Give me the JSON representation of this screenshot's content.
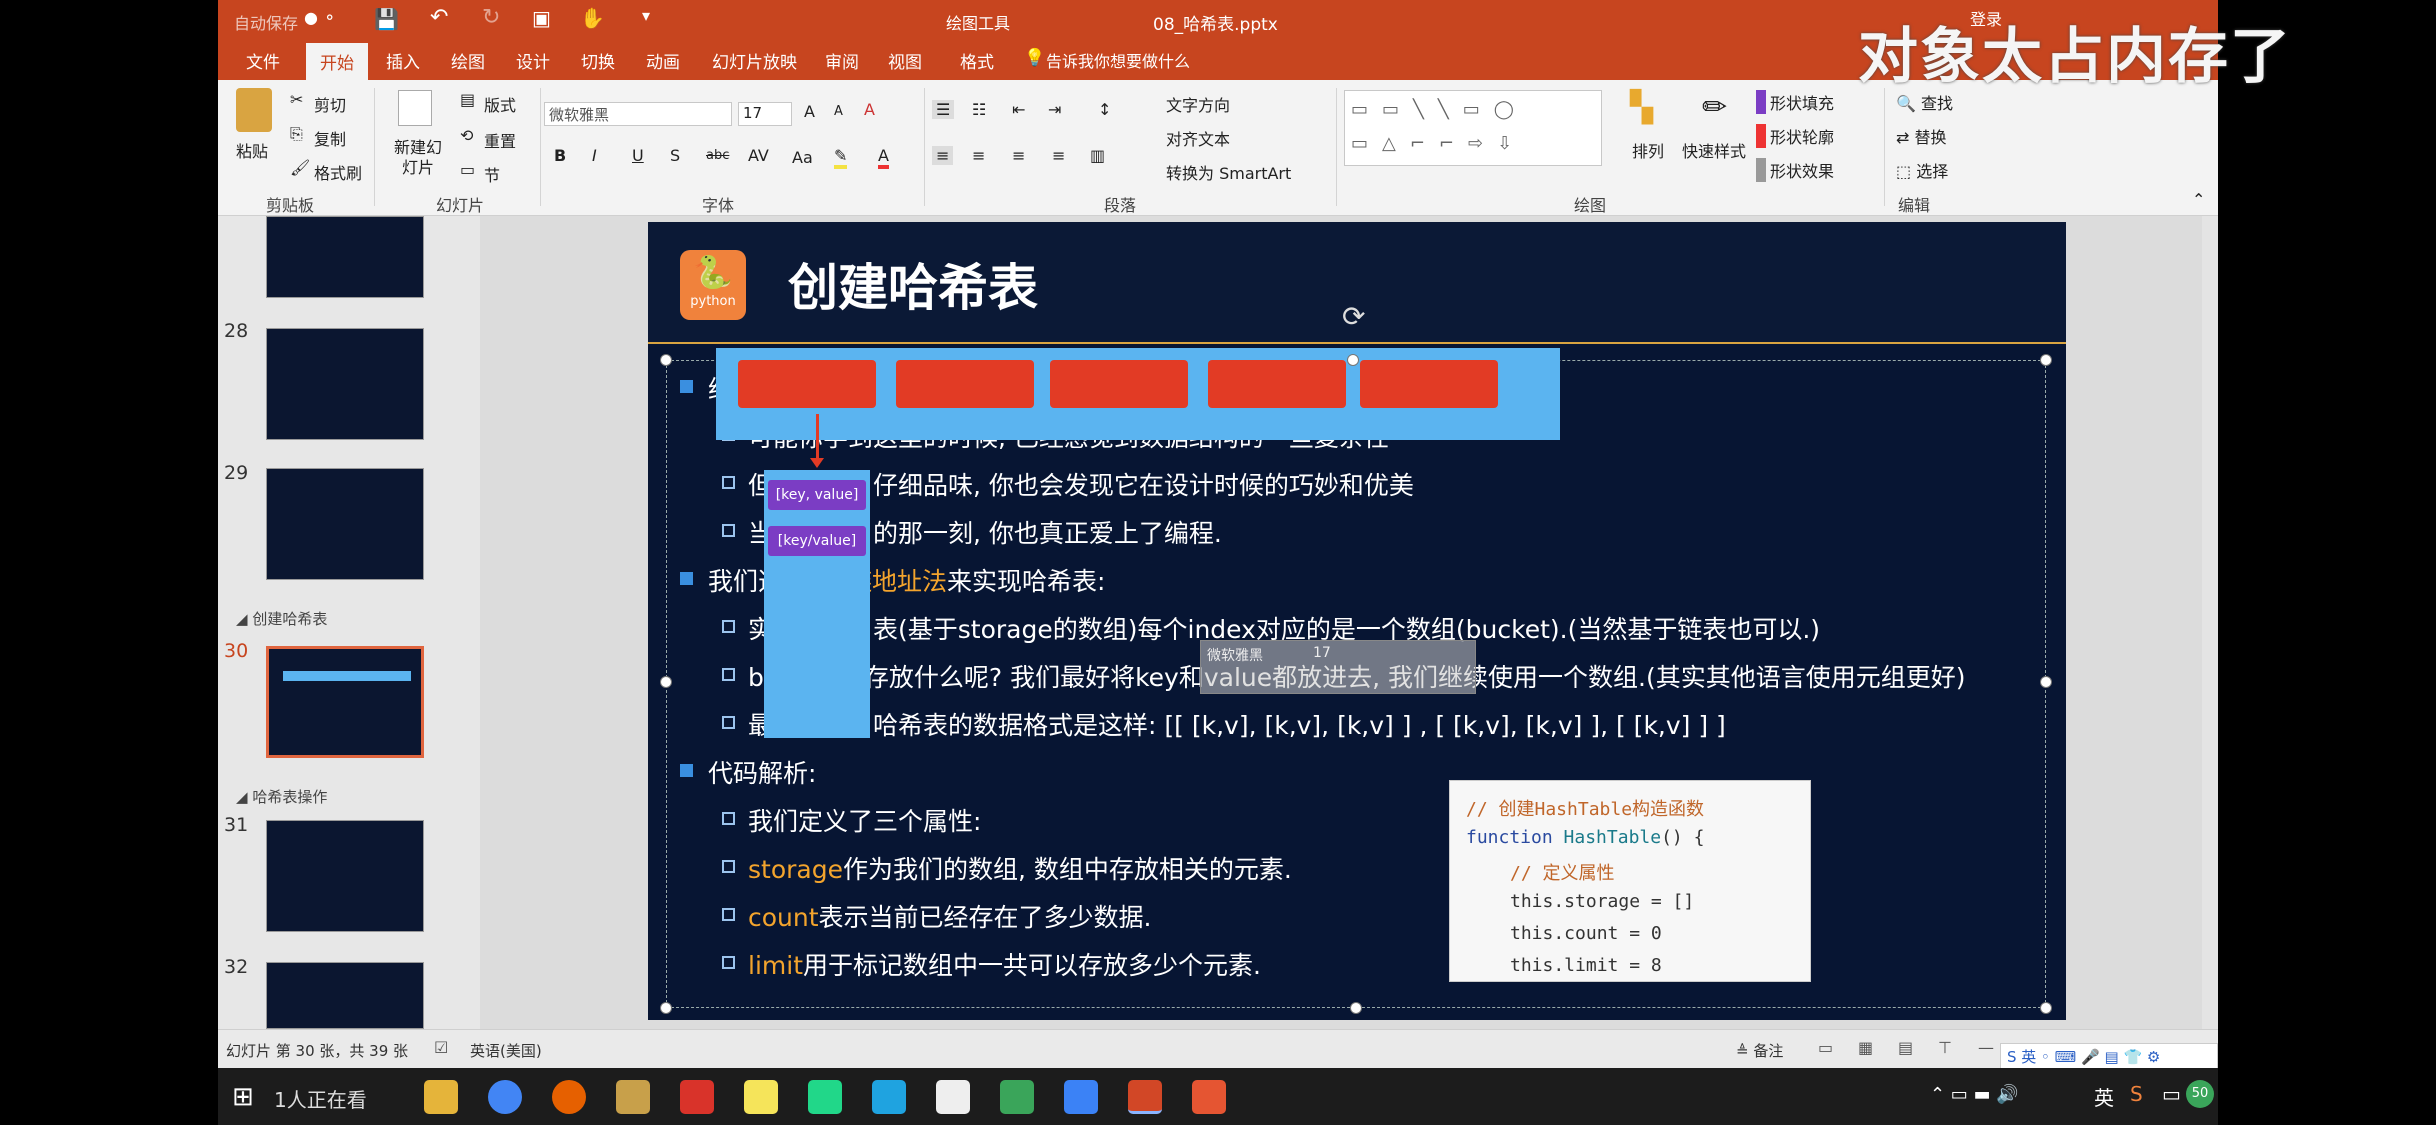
{
  "overlay_caption": "对象太占内存了",
  "titlebar": {
    "autosave": "自动保存",
    "drawing_tools": "绘图工具",
    "filename": "08_哈希表.pptx",
    "login": "登录"
  },
  "tabs": [
    "文件",
    "开始",
    "插入",
    "绘图",
    "设计",
    "切换",
    "动画",
    "幻灯片放映",
    "审阅",
    "视图",
    "格式"
  ],
  "tell_me": "告诉我你想要做什么",
  "ribbon": {
    "paste": "粘贴",
    "cut": "剪切",
    "copy": "复制",
    "format_painter": "格式刷",
    "clipboard_group": "剪贴板",
    "new_slide": "新建幻灯片",
    "layout": "版式",
    "reset": "重置",
    "section": "节",
    "slides_group": "幻灯片",
    "font_name": "微软雅黑",
    "font_size": "17",
    "font_group": "字体",
    "text_direction": "文字方向",
    "align_text": "对齐文本",
    "convert_smartart": "转换为 SmartArt",
    "paragraph_group": "段落",
    "arrange": "排列",
    "quick_styles": "快速样式",
    "shape_fill": "形状填充",
    "shape_outline": "形状轮廓",
    "shape_effects": "形状效果",
    "drawing_group": "绘图",
    "find": "查找",
    "replace": "替换",
    "select": "选择",
    "editing_group": "编辑"
  },
  "thumbnails": [
    {
      "num": "",
      "section": ""
    },
    {
      "num": "28",
      "section": ""
    },
    {
      "num": "29",
      "section": ""
    },
    {
      "num": "30",
      "section": "创建哈希表"
    },
    {
      "num": "31",
      "section": "哈希表操作"
    },
    {
      "num": "32",
      "section": ""
    }
  ],
  "slide": {
    "title": "创建哈希表",
    "logo_text": "python",
    "bullets": [
      {
        "level": 1,
        "text": "经"
      },
      {
        "level": 2,
        "text": "可能你学到这里的时候, 已经感觉到数据结构的一些复杂性"
      },
      {
        "level": 2,
        "pre": "但",
        "text": "仔细品味, 你也会发现它在设计时候的巧妙和优美"
      },
      {
        "level": 2,
        "pre": "当",
        "text": "的那一刻, 你也真正爱上了编程."
      },
      {
        "level": 1,
        "pre": "我们选",
        "hl": "链地址法",
        "text": "来实现哈希表:"
      },
      {
        "level": 2,
        "pre": "实",
        "text": "表(基于storage的数组)每个index对应的是一个数组(bucket).(当然基于链表也可以.)"
      },
      {
        "level": 2,
        "pre": "b",
        "text": "存放什么呢? 我们最好将key和value都放进去, 我们继续使用一个数组.(其实其他语言使用元组更好)"
      },
      {
        "level": 2,
        "pre": "最",
        "text": "哈希表的数据格式是这样: [[ [k,v], [k,v], [k,v] ] , [ [k,v], [k,v] ], [ [k,v] ] ]"
      },
      {
        "level": 1,
        "text": "代码解析:"
      },
      {
        "level": 2,
        "text": "我们定义了三个属性:"
      },
      {
        "level": 2,
        "hl": "storage",
        "text": "作为我们的数组, 数组中存放相关的元素."
      },
      {
        "level": 2,
        "hl": "count",
        "text": "表示当前已经存在了多少数据."
      },
      {
        "level": 2,
        "hl": "limit",
        "text": "用于标记数组中一共可以存放多少个元素."
      }
    ],
    "kv_labels": [
      "[key, value]",
      "[key/value]"
    ],
    "mini_toolbar": {
      "font": "微软雅黑",
      "size": "17"
    },
    "code": {
      "comment1": "// 创建HashTable构造函数",
      "line2_kw": "function",
      "line2_fn": "HashTable",
      "line2_rest": "() {",
      "comment2": "// 定义属性",
      "line4": "this.storage = []",
      "line5": "this.count = 0",
      "line6": "this.limit = 8"
    }
  },
  "statusbar": {
    "slide_info": "幻灯片 第 30 张，共 39 张",
    "language": "英语(美国)",
    "notes": "备注"
  },
  "taskbar": {
    "search_text": "1人正在看",
    "tray_lang": "英",
    "badge": "50"
  },
  "colors": {
    "accent": "#c7451f",
    "slide_bg": "#071533",
    "highlight": "#f3a42d",
    "bucket": "#e23b25",
    "array_bg": "#5bb4f0",
    "kv_purple": "#7b3dc4"
  }
}
